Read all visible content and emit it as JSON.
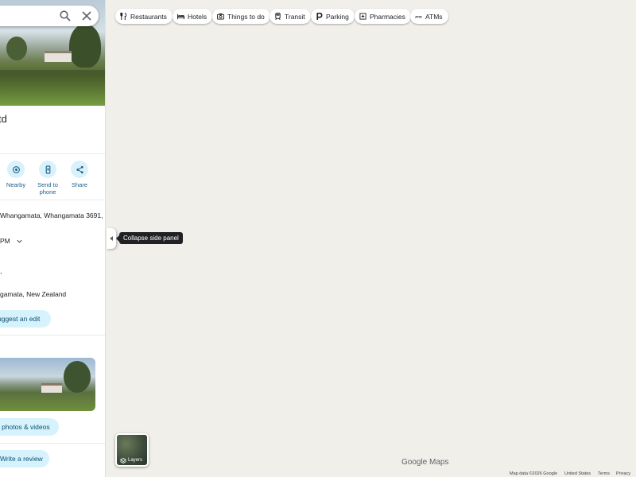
{
  "search": {
    "value": ""
  },
  "place": {
    "title_fragment": "td"
  },
  "actions": [
    {
      "label": "Nearby"
    },
    {
      "label": "Send to phone"
    },
    {
      "label": "Share"
    }
  ],
  "info": {
    "address": "Whangamata, Whangamata 3691,",
    "hours": "PM",
    "plus_code": ",",
    "location": "gamata, New Zealand",
    "suggest_edit": "uggest an edit"
  },
  "photos": {
    "add_photos": "d photos & videos",
    "write_review": "Write a review"
  },
  "categories": [
    {
      "label": "Restaurants",
      "icon": "fork-knife-icon"
    },
    {
      "label": "Hotels",
      "icon": "bed-icon"
    },
    {
      "label": "Things to do",
      "icon": "camera-icon"
    },
    {
      "label": "Transit",
      "icon": "train-icon"
    },
    {
      "label": "Parking",
      "icon": "parking-icon"
    },
    {
      "label": "Pharmacies",
      "icon": "pharmacy-icon"
    },
    {
      "label": "ATMs",
      "icon": "atm-icon"
    }
  ],
  "map": {
    "collapse_tooltip": "Collapse side panel",
    "layers_label": "Layers",
    "logo": "Google Maps",
    "footer": {
      "map_data": "Map data ©2026 Google",
      "region": "United States",
      "terms": "Terms",
      "privacy": "Privacy"
    }
  },
  "colors": {
    "map_bg": "#f1efe9",
    "pill_bg": "#d6f2fc",
    "accent_text": "#0e4f72"
  }
}
